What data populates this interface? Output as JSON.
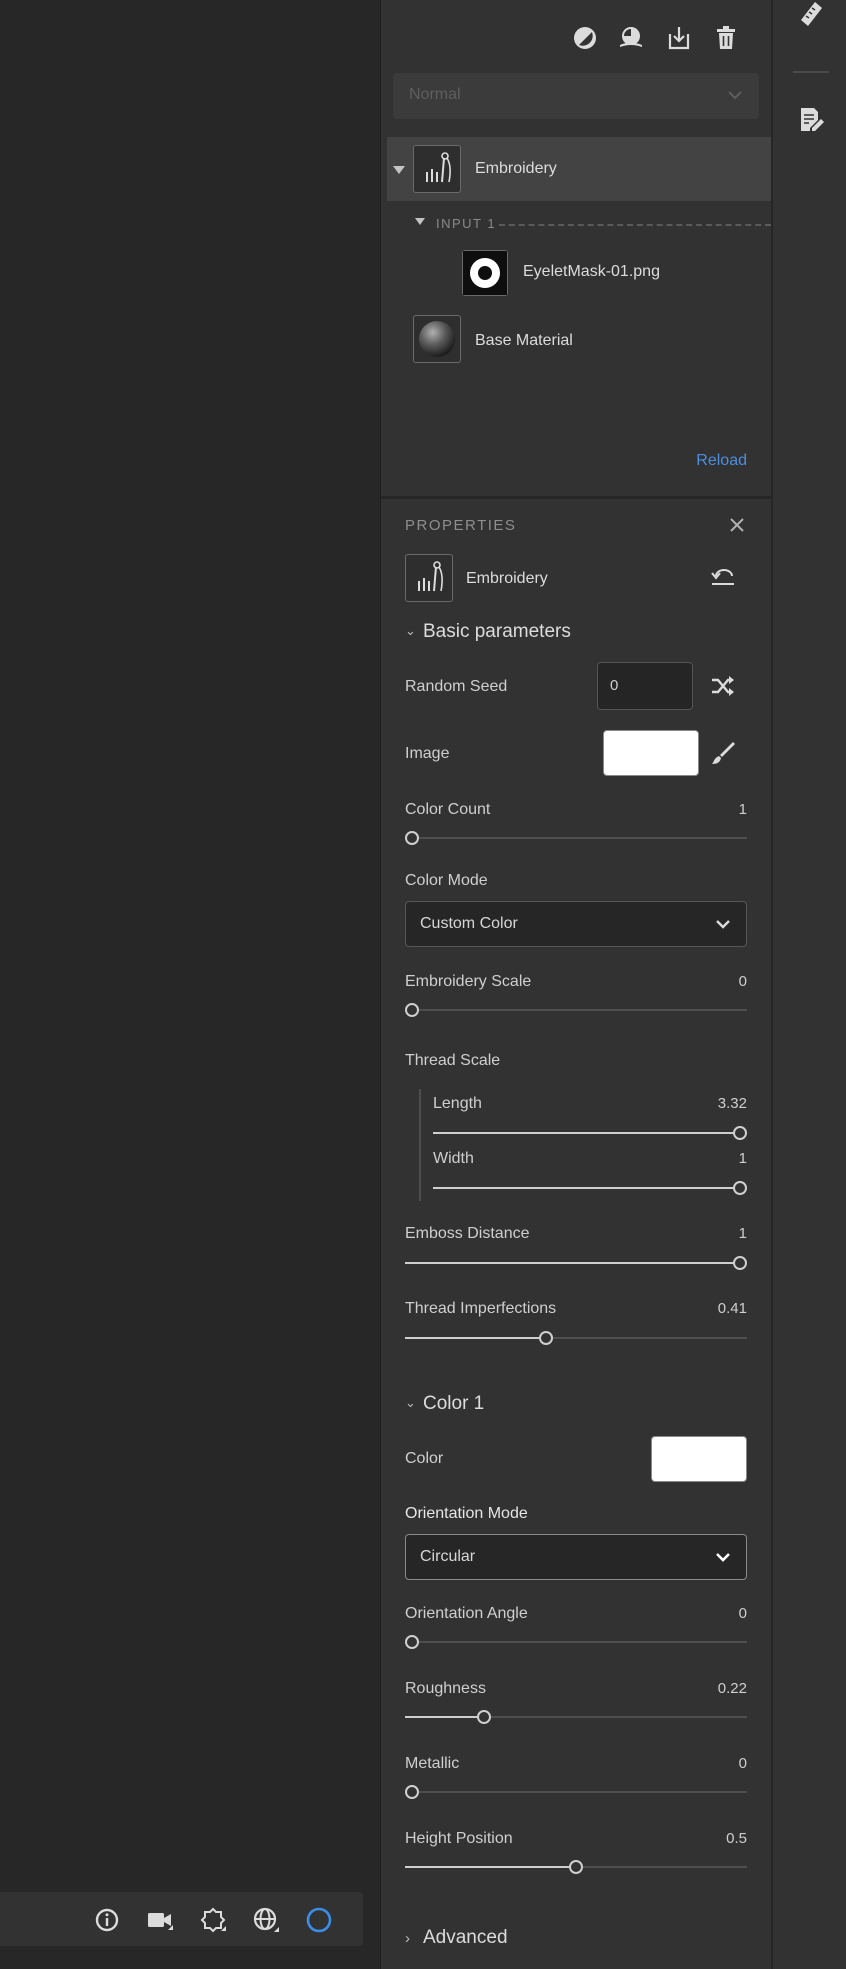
{
  "layers": {
    "blend_mode": "Normal",
    "items": [
      {
        "label": "Embroidery"
      },
      {
        "label": "EyeletMask-01.png"
      },
      {
        "label": "Base Material"
      }
    ],
    "input_label": "INPUT 1",
    "reload_label": "Reload"
  },
  "properties": {
    "header": "PROPERTIES",
    "filter_name": "Embroidery",
    "basic_section": "Basic parameters",
    "random_seed": {
      "label": "Random Seed",
      "value": "0"
    },
    "image": {
      "label": "Image"
    },
    "color_count": {
      "label": "Color Count",
      "value": "1",
      "fraction": 0
    },
    "color_mode": {
      "label": "Color Mode",
      "selected": "Custom Color"
    },
    "embroidery_scale": {
      "label": "Embroidery Scale",
      "value": "0",
      "fraction": 0
    },
    "thread_scale": {
      "label": "Thread Scale",
      "length": {
        "label": "Length",
        "value": "3.32",
        "fraction": 1
      },
      "width": {
        "label": "Width",
        "value": "1",
        "fraction": 1
      }
    },
    "emboss_distance": {
      "label": "Emboss Distance",
      "value": "1",
      "fraction": 1
    },
    "thread_imperfections": {
      "label": "Thread Imperfections",
      "value": "0.41",
      "fraction": 0.41
    },
    "color1_section": "Color 1",
    "color": {
      "label": "Color",
      "hex": "#ffffff"
    },
    "orientation_mode": {
      "label": "Orientation Mode",
      "selected": "Circular"
    },
    "orientation_angle": {
      "label": "Orientation Angle",
      "value": "0",
      "fraction": 0
    },
    "roughness": {
      "label": "Roughness",
      "value": "0.22",
      "fraction": 0.22
    },
    "metallic": {
      "label": "Metallic",
      "value": "0",
      "fraction": 0
    },
    "height_position": {
      "label": "Height Position",
      "value": "0.5",
      "fraction": 0.5
    },
    "advanced_section": "Advanced"
  },
  "colors": {
    "accent": "#4a8fe0",
    "panel_bg": "#323232",
    "viewport_bg": "#272727"
  },
  "icons": {
    "layers_toolbar": [
      "mask-icon",
      "fill-icon",
      "import-icon",
      "trash-icon"
    ],
    "right_rail": [
      "ruler-icon",
      "notes-icon"
    ],
    "viewport_toolbar": [
      "info-icon",
      "camera-icon",
      "light-icon",
      "environment-icon",
      "render-icon"
    ]
  }
}
